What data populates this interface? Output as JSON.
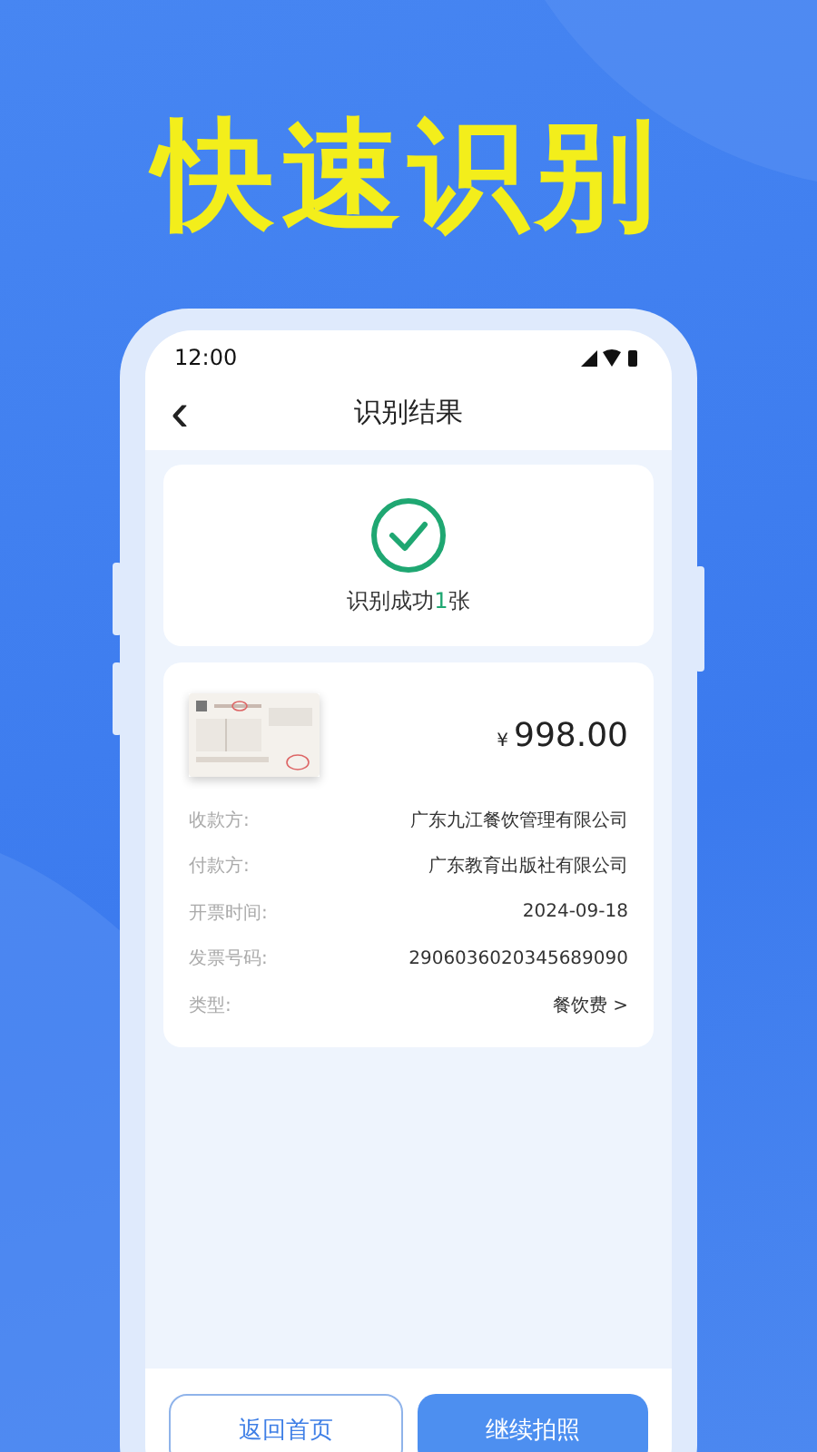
{
  "headline": "快速识别",
  "status_bar": {
    "time": "12:00"
  },
  "nav": {
    "back": "‹",
    "title": "识别结果"
  },
  "result": {
    "prefix": "识别成功",
    "count": "1",
    "suffix": "张"
  },
  "invoice": {
    "kind": "picture",
    "currency": "¥",
    "amount": "998.00",
    "rows": [
      {
        "kind": "plain",
        "label": "收款方:",
        "value": "广东九江餐饮管理有限公司"
      },
      {
        "kind": "plain",
        "label": "付款方:",
        "value": "广东教育出版社有限公司"
      },
      {
        "kind": "plain",
        "label": "开票时间:",
        "value": "2024-09-18"
      },
      {
        "kind": "plain",
        "label": "发票号码:",
        "value": "2906036020345689090"
      },
      {
        "kind": "link",
        "label": "类型:",
        "value": "餐饮费",
        "chevron": ">"
      }
    ]
  },
  "buttons": [
    {
      "kind": "outline",
      "label": "返回首页"
    },
    {
      "kind": "filled",
      "label": "继续拍照"
    }
  ]
}
